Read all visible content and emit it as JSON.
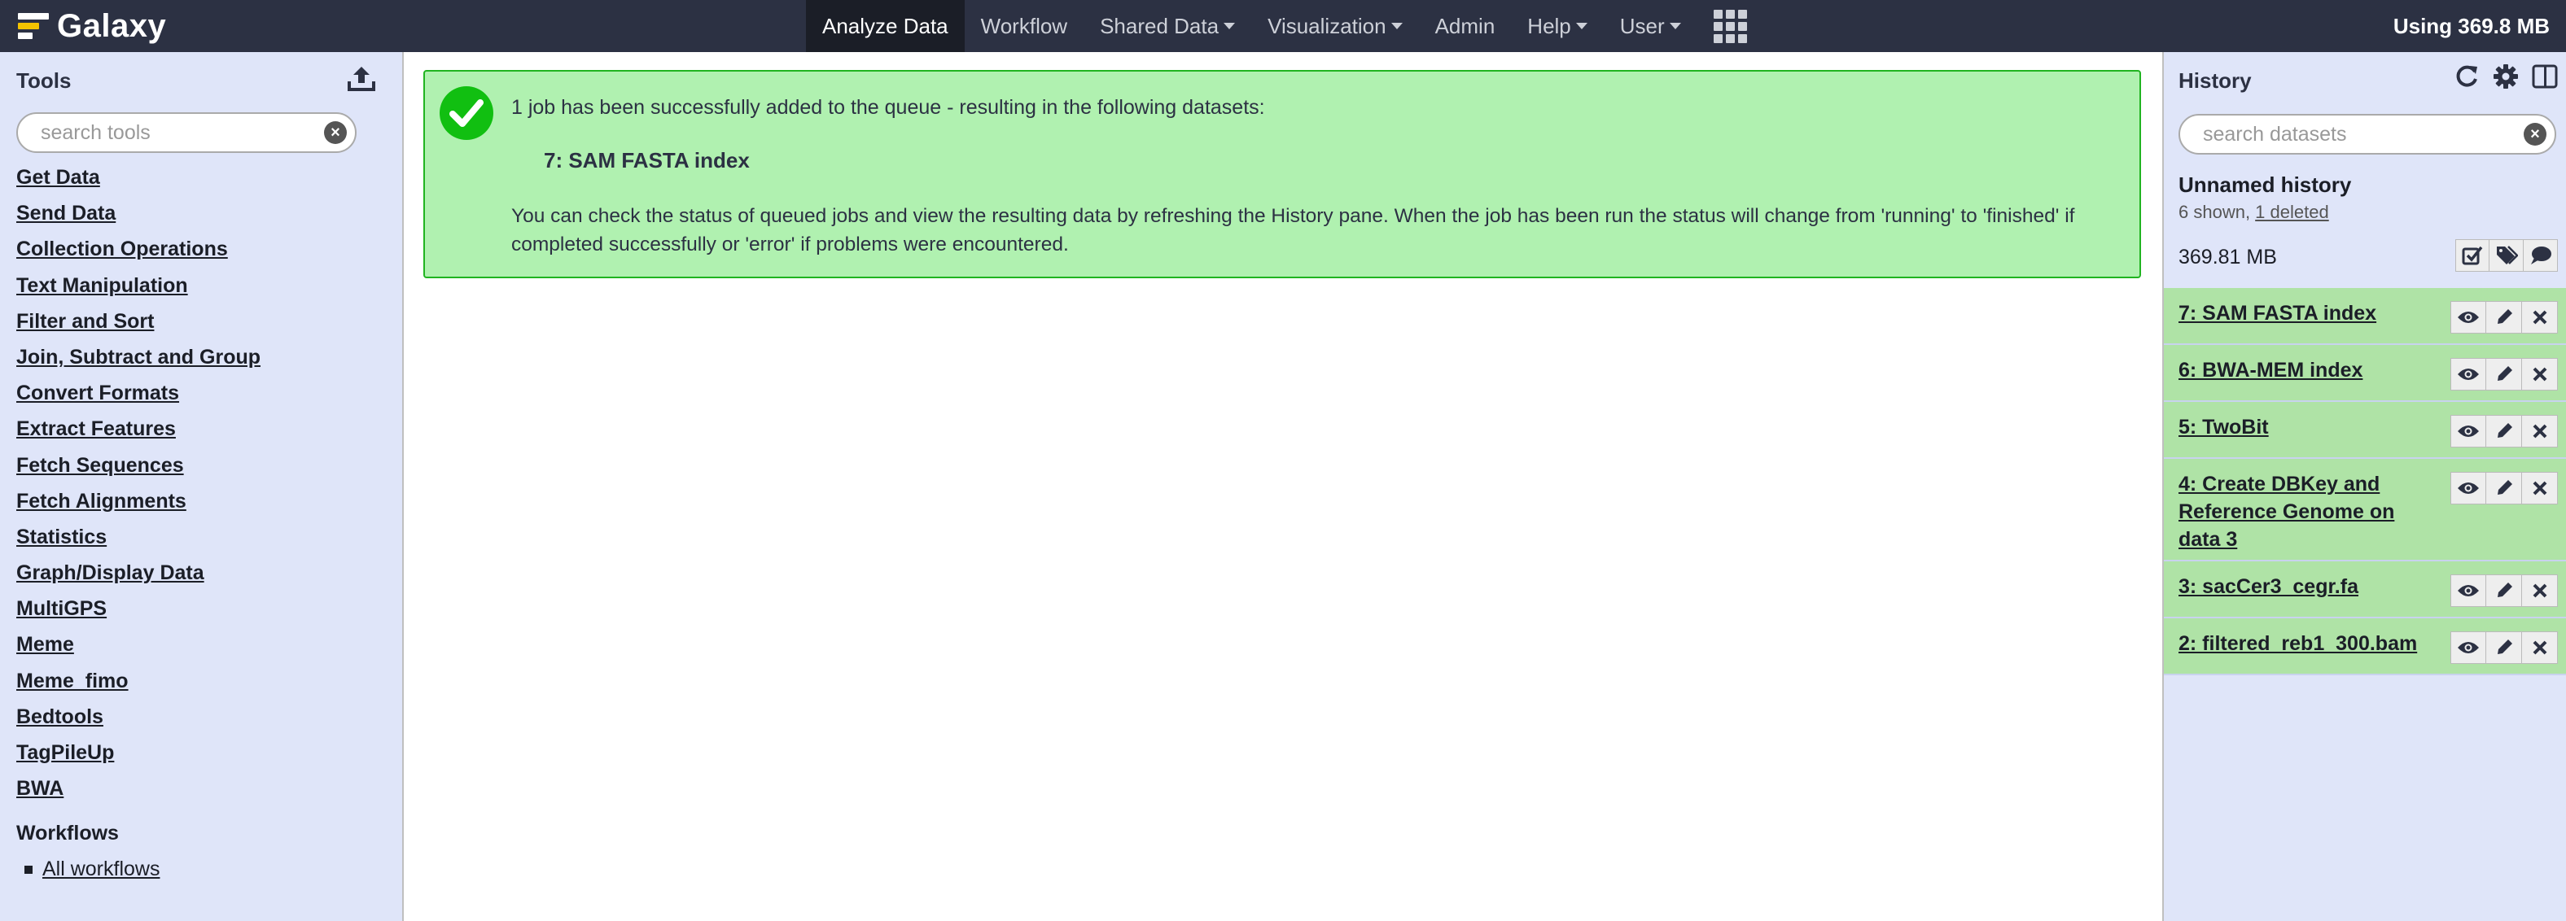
{
  "brand": {
    "name": "Galaxy"
  },
  "nav": {
    "items": [
      {
        "label": "Analyze Data",
        "dropdown": false
      },
      {
        "label": "Workflow",
        "dropdown": false
      },
      {
        "label": "Shared Data",
        "dropdown": true
      },
      {
        "label": "Visualization",
        "dropdown": true
      },
      {
        "label": "Admin",
        "dropdown": false
      },
      {
        "label": "Help",
        "dropdown": true
      },
      {
        "label": "User",
        "dropdown": true
      }
    ],
    "quota": "Using 369.8 MB"
  },
  "tools": {
    "title": "Tools",
    "search_placeholder": "search tools",
    "sections": [
      "Get Data",
      "Send Data",
      "Collection Operations",
      "Text Manipulation",
      "Filter and Sort",
      "Join, Subtract and Group",
      "Convert Formats",
      "Extract Features",
      "Fetch Sequences",
      "Fetch Alignments",
      "Statistics",
      "Graph/Display Data",
      "MultiGPS",
      "Meme",
      "Meme_fimo",
      "Bedtools",
      "TagPileUp",
      "BWA"
    ],
    "workflows_title": "Workflows",
    "all_workflows": "All workflows"
  },
  "message": {
    "line1": "1 job has been successfully added to the queue - resulting in the following datasets:",
    "dataset": "7: SAM FASTA index",
    "body": "You can check the status of queued jobs and view the resulting data by refreshing the History pane. When the job has been run the status will change from 'running' to 'finished' if completed successfully or 'error' if problems were encountered."
  },
  "history": {
    "title": "History",
    "search_placeholder": "search datasets",
    "name": "Unnamed history",
    "shown": "6 shown, ",
    "deleted": "1 deleted",
    "size": "369.81 MB",
    "datasets": [
      {
        "title": "7: SAM FASTA index"
      },
      {
        "title": "6: BWA-MEM index"
      },
      {
        "title": "5: TwoBit"
      },
      {
        "title": "4: Create DBKey and Reference Genome on data 3"
      },
      {
        "title": "3: sacCer3_cegr.fa"
      },
      {
        "title": "2: filtered_reb1_300.bam"
      }
    ]
  },
  "colors": {
    "masthead": "#2c3143",
    "panel": "#dfe5f9",
    "ok_background": "#b0f1b0",
    "dataset_ok": "#afe3a6"
  }
}
